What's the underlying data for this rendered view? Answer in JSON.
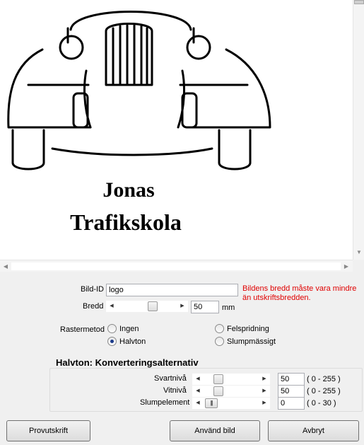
{
  "logo": {
    "line1": "Jonas",
    "line2": "Trafikskola"
  },
  "form": {
    "bild_id_label": "Bild-ID",
    "bild_id_value": "logo",
    "error_message": "Bildens bredd måste vara mindre än utskriftsbredden.",
    "bredd_label": "Bredd",
    "bredd_value": "50",
    "bredd_unit": "mm",
    "bredd_slider_level": 0.62
  },
  "raster": {
    "label": "Rastermetod",
    "options": [
      {
        "label": "Ingen",
        "checked": false
      },
      {
        "label": "Halvton",
        "checked": true
      },
      {
        "label": "Felspridning",
        "checked": false
      },
      {
        "label": "Slumpmässigt",
        "checked": false
      }
    ]
  },
  "halftone": {
    "title": "Halvton: Konverteringsalternativ",
    "rows": [
      {
        "label": "Svartnivå",
        "value": "50",
        "range": "( 0 - 255 )",
        "slider_level": 0.2
      },
      {
        "label": "Vitnivå",
        "value": "50",
        "range": "( 0 - 255 )",
        "slider_level": 0.2
      },
      {
        "label": "Slumpelement",
        "value": "0",
        "range": "( 0 - 30 )",
        "slider_level": 0.0
      }
    ]
  },
  "buttons": {
    "preview": "Provutskrift",
    "use": "Använd bild",
    "cancel": "Avbryt"
  }
}
